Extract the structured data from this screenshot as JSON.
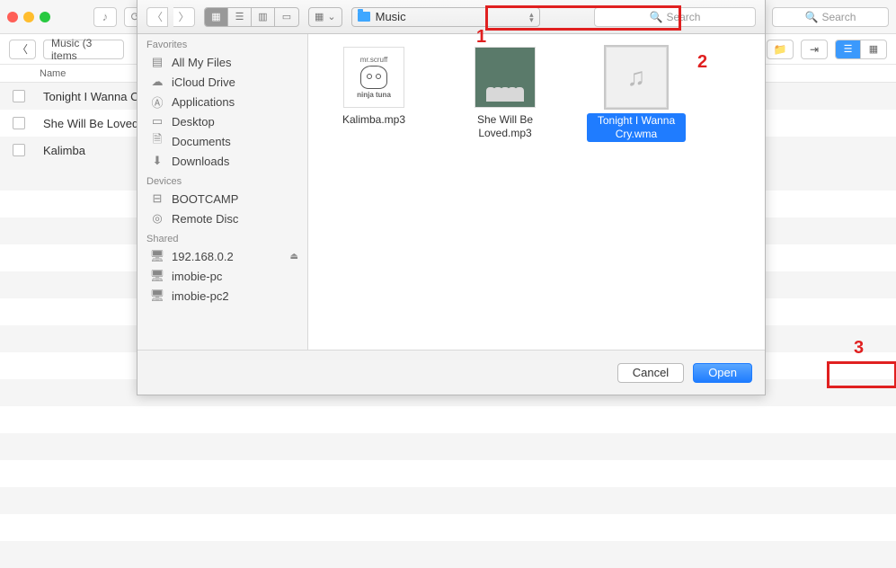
{
  "back": {
    "search_placeholder": "Search",
    "breadcrumb": "Music (3 items",
    "name_col": "Name",
    "rows": [
      "Tonight I Wanna C",
      "She Will Be Loved",
      "Kalimba"
    ]
  },
  "dialog": {
    "location": "Music",
    "search_placeholder": "Search",
    "sidebar": {
      "favorites_label": "Favorites",
      "favorites": [
        "All My Files",
        "iCloud Drive",
        "Applications",
        "Desktop",
        "Documents",
        "Downloads"
      ],
      "devices_label": "Devices",
      "devices": [
        "BOOTCAMP",
        "Remote Disc"
      ],
      "shared_label": "Shared",
      "shared": [
        "192.168.0.2",
        "imobie-pc",
        "imobie-pc2"
      ]
    },
    "files": [
      {
        "name": "Kalimba.mp3",
        "thumb_top": "mr.scruff",
        "thumb_bottom": "ninja tuna"
      },
      {
        "name": "She Will Be Loved.mp3"
      },
      {
        "name": "Tonight I Wanna Cry.wma",
        "selected": true
      }
    ],
    "cancel": "Cancel",
    "open": "Open"
  },
  "annotations": {
    "n1": "1",
    "n2": "2",
    "n3": "3"
  }
}
